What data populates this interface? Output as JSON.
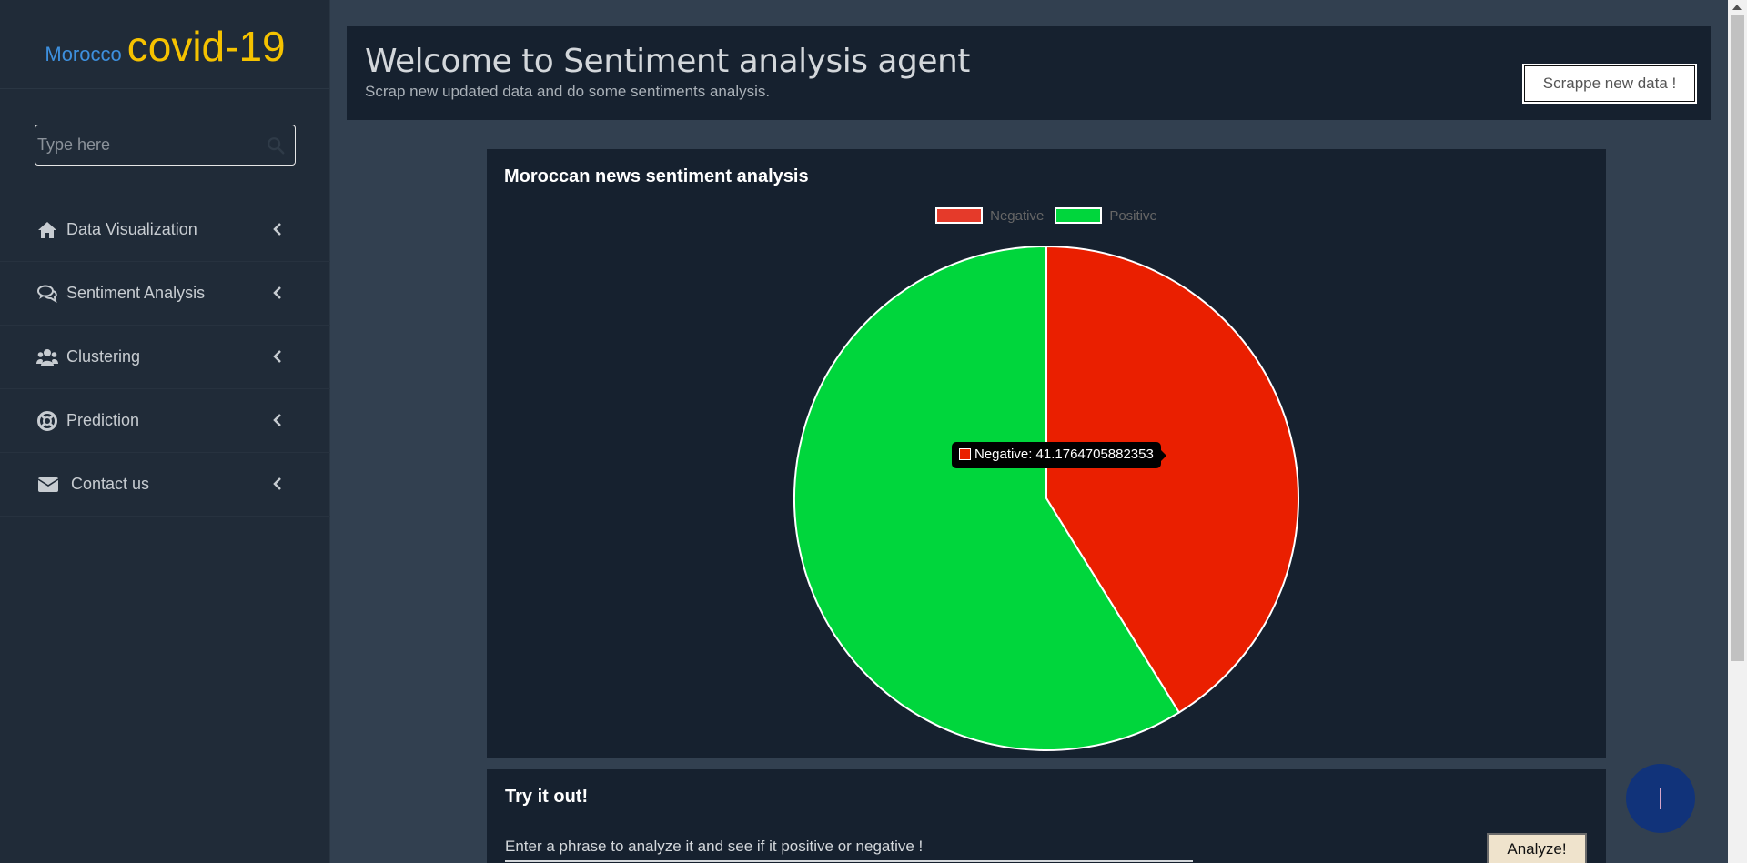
{
  "sidebar": {
    "brand_small": "Morocco",
    "brand_big": "covid-19",
    "search_placeholder": "Type here",
    "items": [
      {
        "label": "Data Visualization",
        "icon": "home-icon"
      },
      {
        "label": "Sentiment Analysis",
        "icon": "comments-icon"
      },
      {
        "label": "Clustering",
        "icon": "users-icon"
      },
      {
        "label": "Prediction",
        "icon": "life-ring-icon"
      },
      {
        "label": "Contact us",
        "icon": "envelope-icon"
      }
    ]
  },
  "header": {
    "title": "Welcome to Sentiment analysis agent",
    "subtitle": "Scrap new updated data and do some sentiments analysis.",
    "scrape_button": "Scrappe new data !"
  },
  "chart_card": {
    "title": "Moroccan news sentiment analysis",
    "tooltip": "Negative: 41.1764705882353"
  },
  "chart_data": {
    "type": "pie",
    "title": "Moroccan news sentiment analysis",
    "labels": [
      "Negative",
      "Positive"
    ],
    "values": [
      41.1764705882353,
      58.8235294117647
    ],
    "colors": [
      "#ea1f00",
      "#00d63c"
    ],
    "legend": "top-center"
  },
  "try_card": {
    "title": "Try it out!",
    "prompt": "Enter a phrase to analyze it and see if it positive or negative !",
    "analyze_button": "Analyze!"
  },
  "colors": {
    "sidebar_bg": "#202b38",
    "page_bg": "#324050",
    "card_bg": "#16212f",
    "brand_accent": "#f5c200",
    "brand_blue": "#3d8fdd"
  }
}
